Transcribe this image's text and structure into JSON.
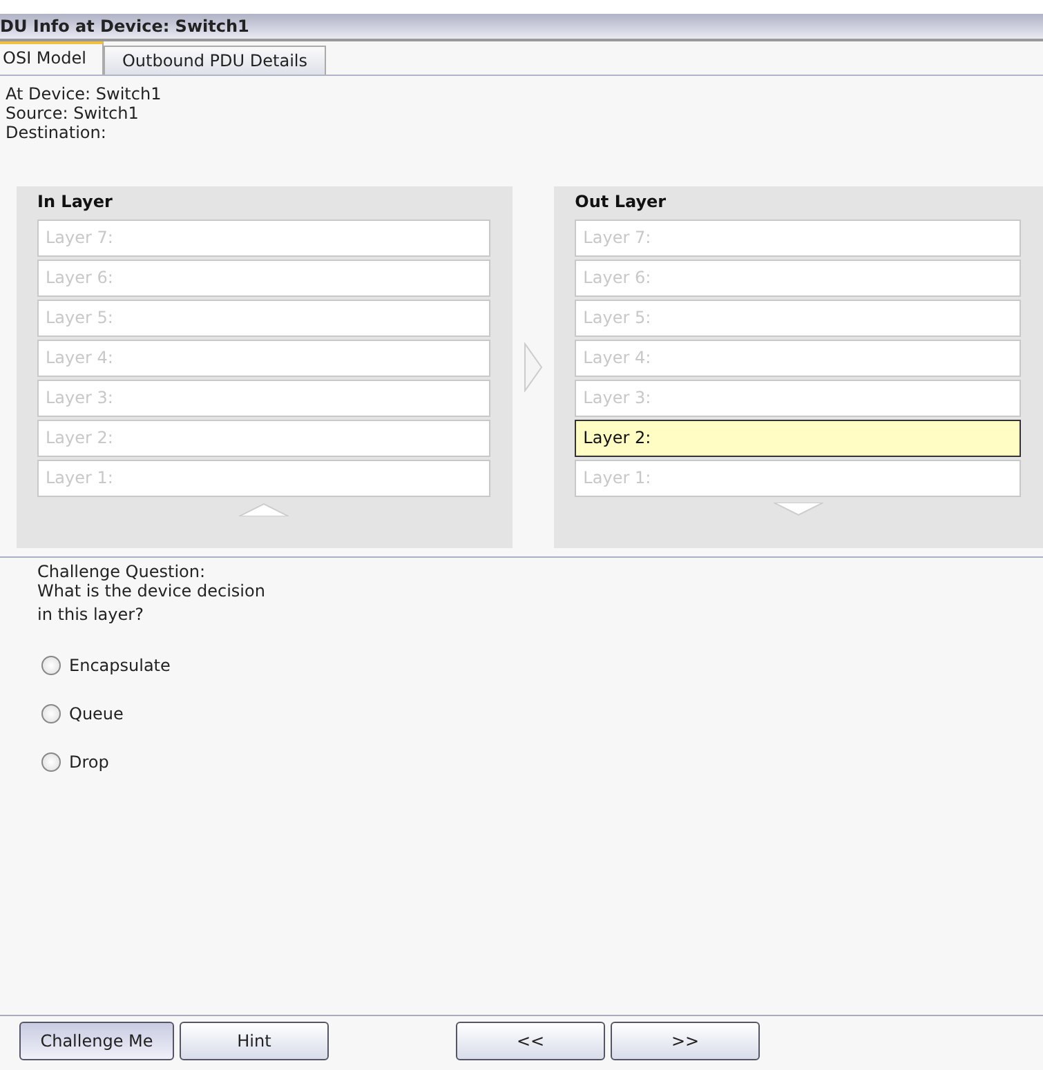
{
  "window": {
    "title": "DU Info at Device: Switch1"
  },
  "tabs": [
    {
      "label": "OSI Model",
      "selected": true
    },
    {
      "label": "Outbound PDU Details",
      "selected": false
    }
  ],
  "info": [
    "At Device: Switch1",
    "Source: Switch1",
    "Destination:"
  ],
  "in_layer": {
    "heading": "In Layer",
    "layers": [
      {
        "label": "Layer 7:",
        "highlighted": false
      },
      {
        "label": "Layer 6:",
        "highlighted": false
      },
      {
        "label": "Layer 5:",
        "highlighted": false
      },
      {
        "label": "Layer 4:",
        "highlighted": false
      },
      {
        "label": "Layer 3:",
        "highlighted": false
      },
      {
        "label": "Layer 2:",
        "highlighted": false
      },
      {
        "label": "Layer 1:",
        "highlighted": false
      }
    ]
  },
  "out_layer": {
    "heading": "Out Layer",
    "layers": [
      {
        "label": "Layer 7:",
        "highlighted": false
      },
      {
        "label": "Layer 6:",
        "highlighted": false
      },
      {
        "label": "Layer 5:",
        "highlighted": false
      },
      {
        "label": "Layer 4:",
        "highlighted": false
      },
      {
        "label": "Layer 3:",
        "highlighted": false
      },
      {
        "label": "Layer 2:",
        "highlighted": true
      },
      {
        "label": "Layer 1:",
        "highlighted": false
      }
    ]
  },
  "question": {
    "title": "Challenge Question:",
    "text": "What is the device decision in this layer?",
    "options": [
      {
        "label": "Encapsulate",
        "selected": false
      },
      {
        "label": "Queue",
        "selected": false
      },
      {
        "label": "Drop",
        "selected": false
      }
    ]
  },
  "buttons": [
    {
      "label": "Challenge Me",
      "pressed": true
    },
    {
      "label": "Hint",
      "pressed": false
    },
    {
      "label": "<<",
      "pressed": false
    },
    {
      "label": ">>",
      "pressed": false
    }
  ]
}
